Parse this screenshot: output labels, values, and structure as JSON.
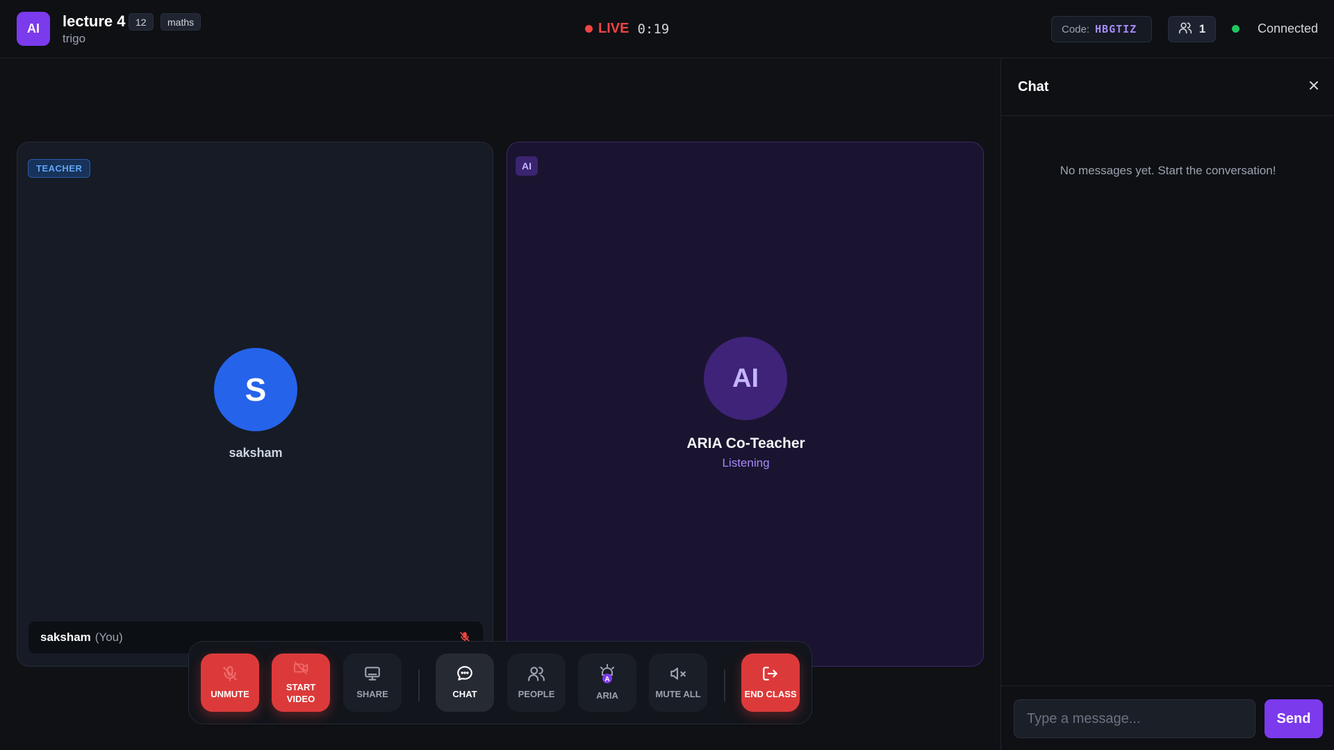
{
  "header": {
    "logo_text": "AI",
    "title": "lecture 4",
    "subtitle": "trigo",
    "grade_chip": "12",
    "subject_chip": "maths",
    "live_label": "LIVE",
    "timer": "0:19",
    "code_label": "Code:",
    "code_value": "HBGTIZ",
    "participant_count": "1",
    "connection_status": "Connected"
  },
  "stage": {
    "teacher_tile": {
      "badge": "TEACHER",
      "avatar_letter": "S",
      "name": "saksham",
      "namebar_name": "saksham",
      "namebar_tag": "(You)"
    },
    "ai_tile": {
      "badge": "AI",
      "avatar_text": "AI",
      "name": "ARIA Co-Teacher",
      "status": "Listening"
    }
  },
  "controls": [
    {
      "label": "UNMUTE",
      "icon": "mic-off-icon"
    },
    {
      "label": "START VIDEO",
      "icon": "video-off-icon"
    },
    {
      "label": "SHARE",
      "icon": "monitor-icon"
    },
    {
      "label": "CHAT",
      "icon": "chat-bubble-icon"
    },
    {
      "label": "PEOPLE",
      "icon": "people-icon"
    },
    {
      "label": "ARIA",
      "icon": "aria-bot-icon"
    },
    {
      "label": "MUTE ALL",
      "icon": "volume-mute-icon"
    },
    {
      "label": "END CLASS",
      "icon": "exit-icon"
    }
  ],
  "chat": {
    "title": "Chat",
    "empty_message": "No messages yet. Start the conversation!",
    "input_placeholder": "Type a message...",
    "send_label": "Send"
  },
  "colors": {
    "accent": "#7c3aed",
    "live": "#ef4444",
    "connected": "#22c55e",
    "danger_button": "#dc3a3a",
    "teacher_avatar": "#2563eb"
  }
}
